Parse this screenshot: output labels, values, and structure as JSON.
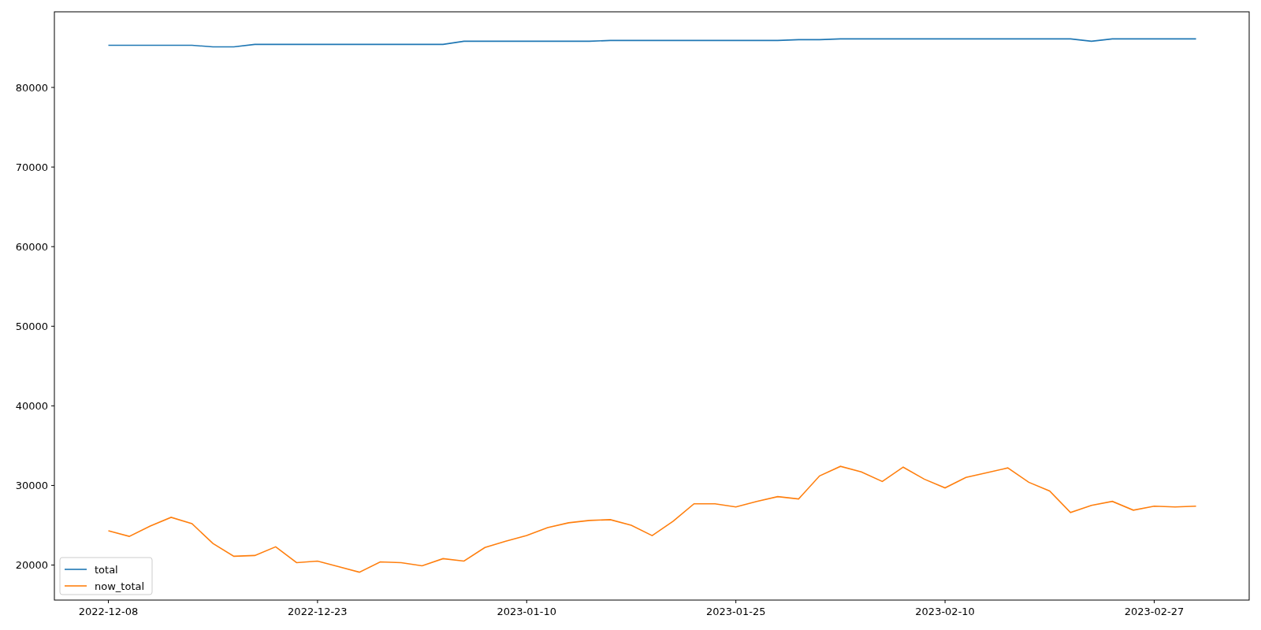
{
  "chart_data": {
    "type": "line",
    "categories": [
      "2022-12-08",
      null,
      null,
      null,
      null,
      null,
      null,
      null,
      null,
      null,
      "2022-12-23",
      null,
      null,
      null,
      null,
      null,
      null,
      null,
      null,
      null,
      "2023-01-10",
      null,
      null,
      null,
      null,
      null,
      null,
      null,
      null,
      null,
      "2023-01-25",
      null,
      null,
      null,
      null,
      null,
      null,
      null,
      null,
      null,
      "2023-02-10",
      null,
      null,
      null,
      null,
      null,
      null,
      null,
      null,
      null,
      "2023-02-27",
      null,
      null
    ],
    "legend": "lower left",
    "ylim": [
      15600,
      89500
    ],
    "yticks": [
      20000,
      30000,
      40000,
      50000,
      60000,
      70000,
      80000
    ],
    "series": [
      {
        "name": "total",
        "color": "#1f77b4",
        "values": [
          85300,
          85300,
          85300,
          85300,
          85300,
          85100,
          85100,
          85400,
          85400,
          85400,
          85400,
          85400,
          85400,
          85400,
          85400,
          85400,
          85400,
          85800,
          85800,
          85800,
          85800,
          85800,
          85800,
          85800,
          85900,
          85900,
          85900,
          85900,
          85900,
          85900,
          85900,
          85900,
          85900,
          86000,
          86000,
          86100,
          86100,
          86100,
          86100,
          86100,
          86100,
          86100,
          86100,
          86100,
          86100,
          86100,
          86100,
          85800,
          86100,
          86100,
          86100,
          86100,
          86100
        ]
      },
      {
        "name": "now_total",
        "color": "#ff7f0e",
        "values": [
          24300,
          23600,
          24900,
          26000,
          25200,
          22700,
          21100,
          21200,
          22300,
          20300,
          20500,
          19800,
          19100,
          20400,
          20300,
          19900,
          20800,
          20500,
          22200,
          23000,
          23700,
          24700,
          25300,
          25600,
          25700,
          25000,
          23700,
          25500,
          27700,
          27700,
          27300,
          28000,
          28600,
          28300,
          31200,
          32400,
          31700,
          30500,
          32300,
          30800,
          29700,
          31000,
          31600,
          32200,
          30400,
          29300,
          26600,
          27500,
          28000,
          26900,
          27400,
          27300,
          27400
        ]
      }
    ]
  }
}
